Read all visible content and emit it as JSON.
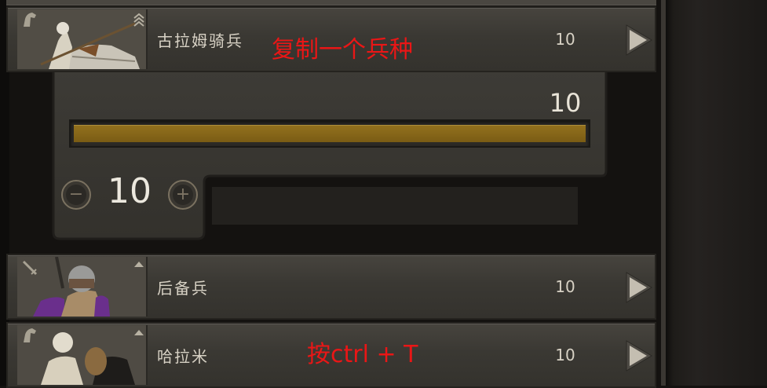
{
  "colors": {
    "panel_bg": "#3a3833",
    "text_primary": "#d7d1c4",
    "slider_fill": "#8a6a1c",
    "annotation_red": "#ea1616"
  },
  "units": [
    {
      "name": "古拉姆骑兵",
      "count": "10",
      "portrait_icon": "horse-icon",
      "tier_icon": "rank-chevrons-icon",
      "expanded": true
    },
    {
      "name": "后备兵",
      "count": "10",
      "portrait_icon": "sword-icon",
      "tier_icon": "rank-triangle-icon",
      "expanded": false
    },
    {
      "name": "哈拉米",
      "count": "10",
      "portrait_icon": "horse-icon",
      "tier_icon": "rank-triangle-icon",
      "expanded": false
    }
  ],
  "transfer_panel": {
    "max_value": "10",
    "current_value": "10",
    "fill_fraction": 1.0,
    "decrease_icon": "minus-icon",
    "increase_icon": "plus-icon"
  },
  "annotations": {
    "copy_unit": "复制一个兵种",
    "press_keys": "按ctrl + T"
  }
}
